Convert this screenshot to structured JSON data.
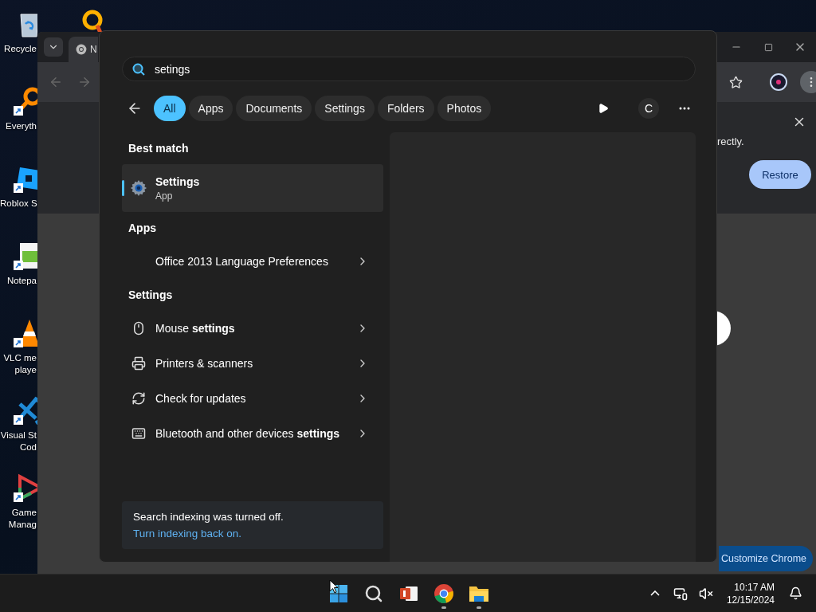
{
  "desktop": {
    "icons": [
      {
        "kind": "bin",
        "lines": [
          "Recycle"
        ],
        "shortcut": false
      },
      {
        "kind": "magnifier",
        "lines": [
          "Everyth"
        ],
        "shortcut": true
      },
      {
        "kind": "tile",
        "lines": [
          "Roblox S"
        ],
        "shortcut": true
      },
      {
        "kind": "notepad",
        "lines": [
          "Notepa"
        ],
        "shortcut": true
      },
      {
        "kind": "cone",
        "lines": [
          "VLC me",
          "playe"
        ],
        "shortcut": true
      },
      {
        "kind": "code",
        "lines": [
          "Visual St",
          "Cod"
        ],
        "shortcut": true
      },
      {
        "kind": "triangle",
        "lines": [
          "Game",
          "Manag"
        ],
        "shortcut": true
      }
    ]
  },
  "browser": {
    "tab": {
      "title": "N"
    },
    "infobar": {
      "text": "rectly.",
      "button": "Restore"
    },
    "customize_button": "Customize Chrome"
  },
  "search": {
    "query": "setings",
    "filters": [
      {
        "label": "All",
        "selected": true
      },
      {
        "label": "Apps",
        "selected": false
      },
      {
        "label": "Documents",
        "selected": false
      },
      {
        "label": "Settings",
        "selected": false
      },
      {
        "label": "Folders",
        "selected": false
      },
      {
        "label": "Photos",
        "selected": false
      }
    ],
    "avatar": "C",
    "sections": [
      {
        "heading": "Best match",
        "kind": "best",
        "items": [
          {
            "title": "Settings",
            "subtitle": "App",
            "kind": "gear",
            "selected": true
          }
        ]
      },
      {
        "heading": "Apps",
        "kind": "list",
        "items": [
          {
            "title": "Office 2013 Language Preferences",
            "kind": "blank",
            "selected": false
          }
        ]
      },
      {
        "heading": "Settings",
        "kind": "list",
        "items": [
          {
            "title": "Mouse **settings**",
            "kind": "mouse",
            "selected": false
          },
          {
            "title": "Printers & scanners",
            "kind": "printer",
            "selected": false
          },
          {
            "title": "Check for updates",
            "kind": "update",
            "selected": false
          },
          {
            "title": "Bluetooth and other devices **settings**",
            "kind": "devices",
            "selected": false
          }
        ]
      }
    ],
    "notice": {
      "text": "Search indexing was turned off.",
      "link": "Turn indexing back on."
    }
  },
  "taskbar": {
    "apps": [
      {
        "kind": "start",
        "running": false
      },
      {
        "kind": "search",
        "running": false
      },
      {
        "kind": "slides",
        "running": false
      },
      {
        "kind": "browser",
        "running": true
      },
      {
        "kind": "folder",
        "running": true
      }
    ],
    "time": "10:17 AM",
    "date": "12/15/2024"
  }
}
